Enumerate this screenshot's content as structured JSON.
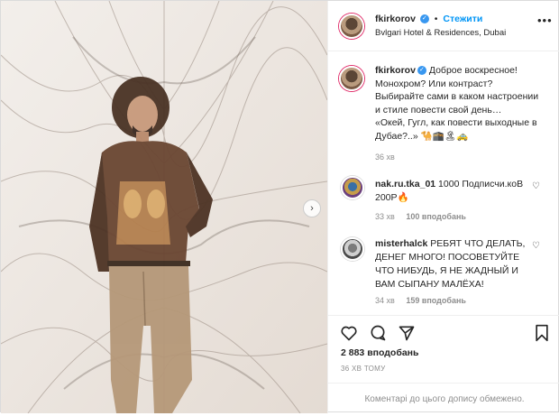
{
  "header": {
    "username": "fkirkorov",
    "follow_label": "Стежити",
    "location": "Bvlgari Hotel & Residences, Dubai",
    "more_glyph": "•••"
  },
  "caption": {
    "username": "fkirkorov",
    "text_lines": [
      "Доброе воскресное!",
      "Монохром? Или контраст?",
      "Выбирайте сами в каком настроении",
      "и стиле повести свой день…",
      "«Окей, Гугл, как повести выходные в",
      "Дубае?..» 🐪🕋🏝🚕"
    ],
    "time": "36 хв"
  },
  "comments": [
    {
      "username": "nak.ru.tka_01",
      "text_line1": "1000 Подписчи.коВ",
      "text_line2": "200Р🔥",
      "time": "33 хв",
      "likes": "100 вподобань"
    },
    {
      "username": "misterhalck",
      "text_line1": "РЕБЯТ ЧТО ДЕЛАТЬ,",
      "text_line2": "ДЕНЕГ МНОГО! ПОСОВЕТУЙТЕ",
      "text_line3": "ЧТО НИБУДЬ, Я НЕ ЖАДНЫЙ И",
      "text_line4": "ВАМ СЫПАНУ МАЛЁХА!",
      "time": "34 хв",
      "likes": "159 вподобань"
    }
  ],
  "actions": {
    "likes_count": "2 883 вподобань",
    "date": "36 ХВ ТОМУ",
    "comments_restricted": "Коментарі до цього допису обмежено."
  },
  "icons": {
    "verified": "verified-badge-icon",
    "like": "heart-icon",
    "comment": "comment-icon",
    "share": "share-icon",
    "save": "bookmark-icon",
    "carousel": "chevron-right-icon"
  },
  "colors": {
    "accent": "#0095f6",
    "verified": "#3897f0",
    "muted": "#8e8e8e",
    "text": "#262626"
  }
}
